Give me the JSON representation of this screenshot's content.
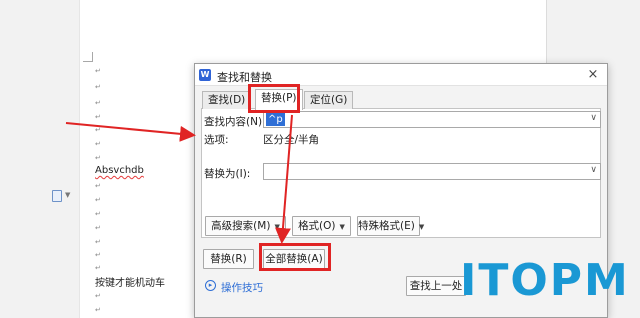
{
  "document": {
    "word": "Absvchdb",
    "sentence": "按键才能机动车",
    "paragraph_mark": "↵"
  },
  "dialog": {
    "app_icon_letter": "W",
    "title": "查找和替换",
    "close": "×",
    "tabs": [
      {
        "label": "查找(D)",
        "selected": false
      },
      {
        "label": "替换(P)",
        "selected": true
      },
      {
        "label": "定位(G)",
        "selected": false
      }
    ],
    "find": {
      "label": "查找内容(N):",
      "value": "^p"
    },
    "options": {
      "label": "选项:",
      "value": "区分全/半角"
    },
    "replace_with": {
      "label": "替换为(I):",
      "value": ""
    },
    "buttons": {
      "advanced": "高级搜索(M)",
      "format": "格式(O)",
      "special": "特殊格式(E)",
      "replace": "替换(R)",
      "replace_all": "全部替换(A)",
      "find_prev": "查找上一处"
    },
    "tips": "操作技巧"
  },
  "annotation_color": "#e02424",
  "watermark": "ITOPM"
}
